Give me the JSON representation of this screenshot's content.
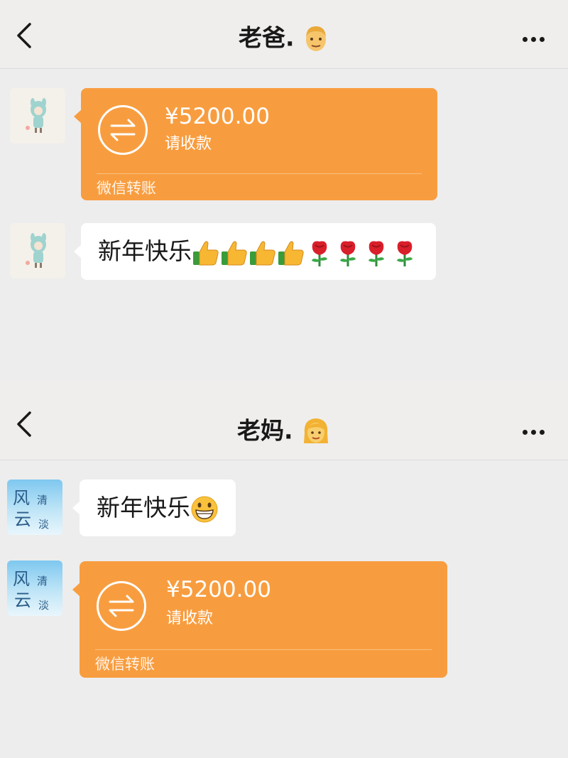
{
  "chat1": {
    "title": "老爸.",
    "title_emoji": "man",
    "messages": [
      {
        "type": "transfer",
        "amount": "¥5200.00",
        "status": "请收款",
        "brand": "微信转账"
      },
      {
        "type": "text",
        "text": "新年快乐",
        "emojis": [
          "thumbs-up",
          "thumbs-up",
          "thumbs-up",
          "thumbs-up",
          "rose",
          "rose",
          "rose",
          "rose"
        ]
      }
    ]
  },
  "chat2": {
    "title": "老妈.",
    "title_emoji": "woman",
    "avatar_text": {
      "a": "风",
      "b": "清",
      "c": "云",
      "d": "淡"
    },
    "messages": [
      {
        "type": "text",
        "text": "新年快乐",
        "emojis": [
          "grinning-face"
        ]
      },
      {
        "type": "transfer",
        "amount": "¥5200.00",
        "status": "请收款",
        "brand": "微信转账"
      }
    ]
  },
  "colors": {
    "transfer_orange": "#f89d3f",
    "chat_bg": "#ededed",
    "bubble_white": "#ffffff"
  }
}
